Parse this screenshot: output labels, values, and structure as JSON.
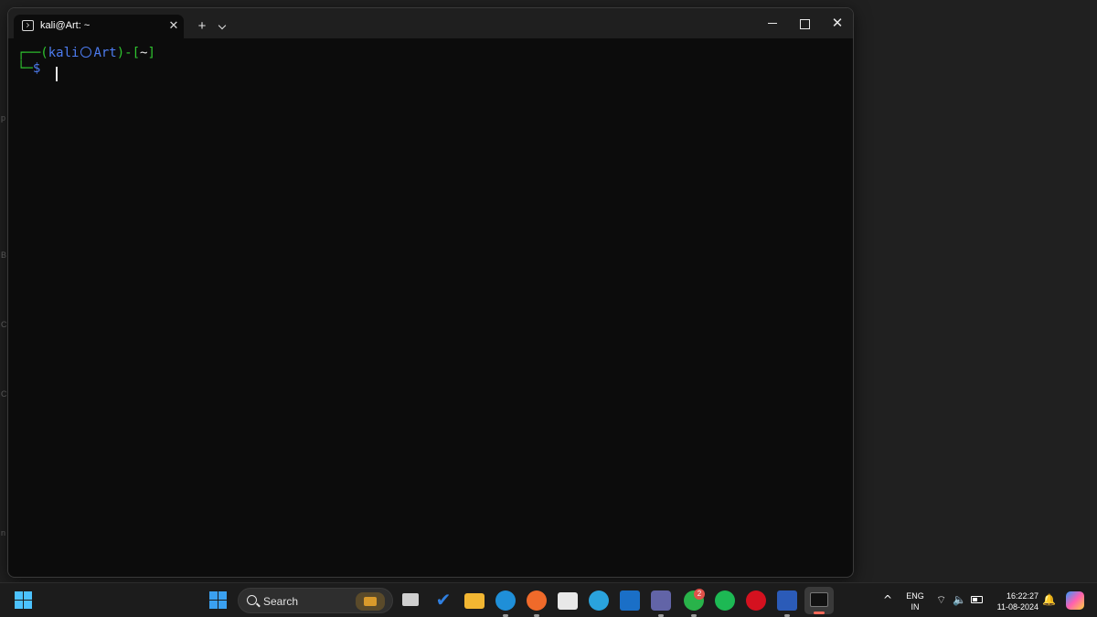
{
  "terminal": {
    "tab_title": "kali@Art: ~",
    "tab_close": "✕",
    "new_tab": "+",
    "close": "✕",
    "prompt": {
      "corner_top": "┌──(",
      "user": "kali",
      "host": "Art",
      "mid": ")-[",
      "dir": "~",
      "end": "]",
      "corner_bottom": "└─",
      "symbol": "$"
    }
  },
  "taskbar": {
    "search_label": "Search",
    "whatsapp_badge": "2",
    "lang_primary": "ENG",
    "lang_secondary": "IN",
    "time": "16:22:27",
    "date": "11-08-2024",
    "tray_chevron": "^",
    "wifi": "⌔",
    "volume": "🔈",
    "bell": "🔔"
  },
  "colors": {
    "accent": "#4cc2ff",
    "prompt_green": "#2fc42f",
    "prompt_blue": "#4d7cf0"
  },
  "icons": [
    "windows-start-icon",
    "search-icon",
    "task-view-icon",
    "todo-icon",
    "file-explorer-icon",
    "edge-icon",
    "firefox-icon",
    "store-icon",
    "telegram-icon",
    "outlook-icon",
    "teams-icon",
    "whatsapp-icon",
    "spotify-icon",
    "opera-icon",
    "word-icon",
    "terminal-icon",
    "wifi-icon",
    "volume-icon",
    "battery-icon",
    "bell-icon",
    "copilot-icon"
  ]
}
